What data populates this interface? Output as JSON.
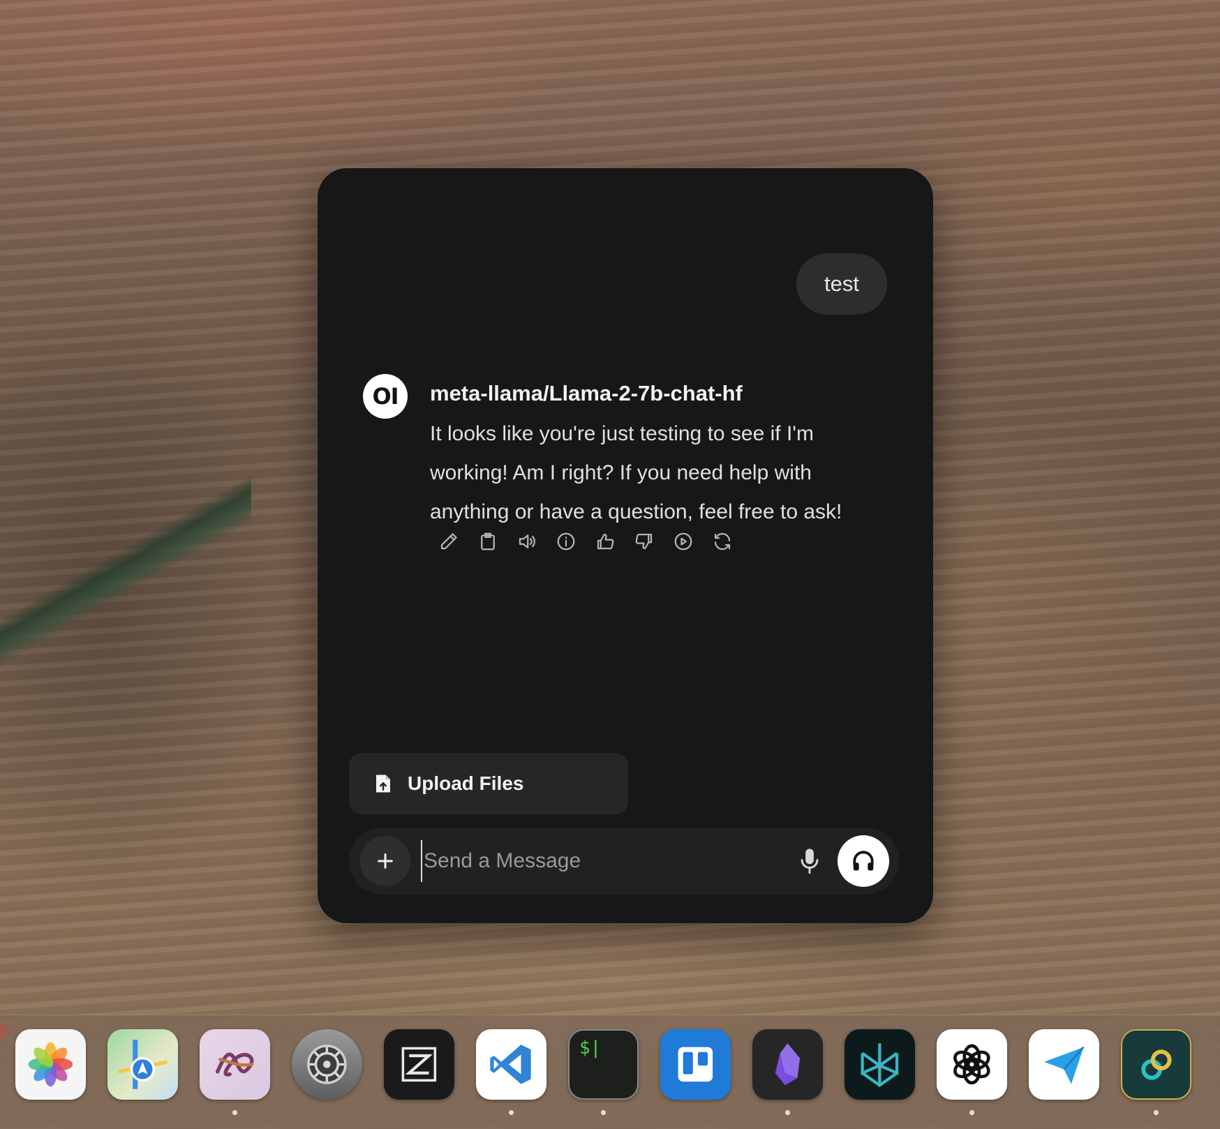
{
  "chat": {
    "user_message": "test",
    "model_name": "meta-llama/Llama-2-7b-chat-hf",
    "avatar_text": "OI",
    "reply": "It looks like you're just testing to see if I'm working! Am I right? If you need help with anything or have a question, feel free to ask!",
    "actions": [
      "edit-icon",
      "copy-icon",
      "read-aloud-icon",
      "info-icon",
      "thumbs-up-icon",
      "thumbs-down-icon",
      "continue-icon",
      "regenerate-icon"
    ]
  },
  "upload": {
    "label": "Upload Files"
  },
  "composer": {
    "placeholder": "Send a Message"
  },
  "dock": {
    "apps": [
      {
        "name": "photos",
        "running": false
      },
      {
        "name": "maps",
        "running": false
      },
      {
        "name": "creative-app",
        "running": true
      },
      {
        "name": "system-settings",
        "running": false
      },
      {
        "name": "zed",
        "running": false
      },
      {
        "name": "vscode",
        "running": true
      },
      {
        "name": "terminal",
        "running": true
      },
      {
        "name": "trello",
        "running": false
      },
      {
        "name": "obsidian",
        "running": true
      },
      {
        "name": "perplexity",
        "running": false
      },
      {
        "name": "chatgpt",
        "running": true
      },
      {
        "name": "telegram",
        "running": false
      },
      {
        "name": "linked-app",
        "running": true
      }
    ],
    "terminal_glyph": "$|"
  },
  "colors": {
    "window_bg": "#171717",
    "bubble_bg": "#2d2d2d",
    "composer_bg": "#212121",
    "vscode_blue": "#2f84d6",
    "trello_blue": "#1f7ad8",
    "obsidian_purple": "#7c4cdb",
    "telegram_blue": "#2aa0e8"
  }
}
